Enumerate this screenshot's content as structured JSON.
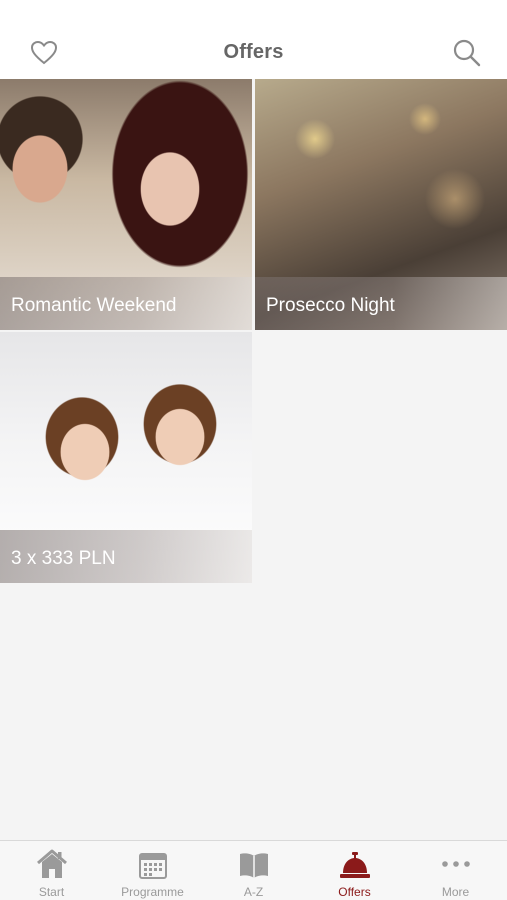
{
  "header": {
    "title": "Offers",
    "favorites_icon": "heart-outline-icon",
    "search_icon": "search-icon"
  },
  "offers": [
    {
      "label": "Romantic Weekend",
      "image": "couple-with-red-wine"
    },
    {
      "label": "Prosecco Night",
      "image": "toasting-glasses-confetti"
    },
    {
      "label": "3 x 333 PLN",
      "image": "two-smiling-girls-in-bathrobes"
    }
  ],
  "tabbar": {
    "tabs": [
      {
        "label": "Start",
        "icon": "home-icon"
      },
      {
        "label": "Programme",
        "icon": "calendar-icon"
      },
      {
        "label": "A-Z",
        "icon": "book-icon"
      },
      {
        "label": "Offers",
        "icon": "service-bell-icon",
        "active": true
      },
      {
        "label": "More",
        "icon": "more-dots-icon"
      }
    ]
  },
  "colors": {
    "accent": "#8b1a1a",
    "inactive_tab": "#9a9a9a",
    "background": "#f4f4f4",
    "header_bg": "#ffffff",
    "title_text": "#666666"
  }
}
